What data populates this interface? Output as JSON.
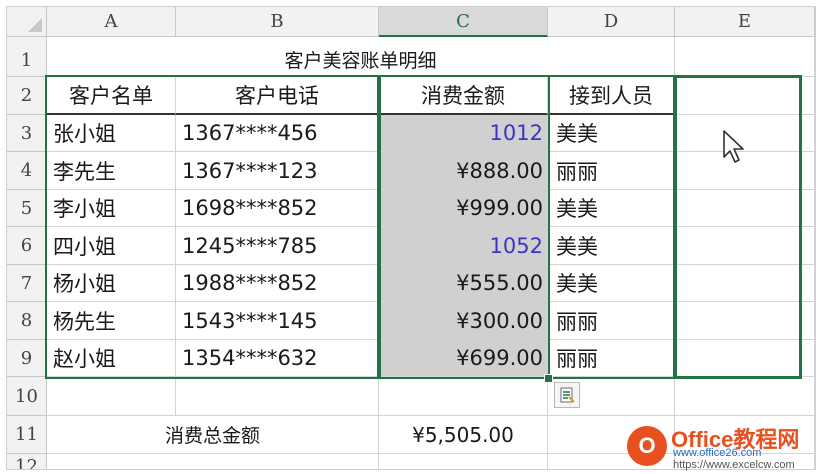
{
  "columns": [
    "A",
    "B",
    "C",
    "D",
    "E"
  ],
  "rows": [
    "1",
    "2",
    "3",
    "4",
    "5",
    "6",
    "7",
    "8",
    "9",
    "10",
    "11",
    "12"
  ],
  "title": "客户美容账单明细",
  "headers": [
    "客户名单",
    "客户电话",
    "消费金额",
    "接到人员"
  ],
  "records": [
    {
      "name": "张小姐",
      "phone": "1367****456",
      "amount": "1012",
      "staff": "美美"
    },
    {
      "name": "李先生",
      "phone": "1367****123",
      "amount": "¥888.00",
      "staff": "丽丽"
    },
    {
      "name": "李小姐",
      "phone": "1698****852",
      "amount": "¥999.00",
      "staff": "美美"
    },
    {
      "name": "四小姐",
      "phone": "1245****785",
      "amount": "1052",
      "staff": "美美"
    },
    {
      "name": "杨小姐",
      "phone": "1988****852",
      "amount": "¥555.00",
      "staff": "美美"
    },
    {
      "name": "杨先生",
      "phone": "1543****145",
      "amount": "¥300.00",
      "staff": "丽丽"
    },
    {
      "name": "赵小姐",
      "phone": "1354****632",
      "amount": "¥699.00",
      "staff": "丽丽"
    }
  ],
  "total": {
    "label": "消费总金额",
    "value": "¥5,505.00"
  },
  "selected_column": "C",
  "colors": {
    "selection": "#217346",
    "shaded_cell": "#d0d0d0",
    "text_number_blue": "#3a35c8",
    "watermark": "#e8501f"
  },
  "icons": {
    "quick_analysis": "quick-analysis-icon",
    "cursor": "mouse-pointer-icon"
  },
  "watermark": {
    "logo_letter": "O",
    "title": "Office教程网",
    "url1": "www.office26.com",
    "url2": "https://www.excelcw.com"
  }
}
